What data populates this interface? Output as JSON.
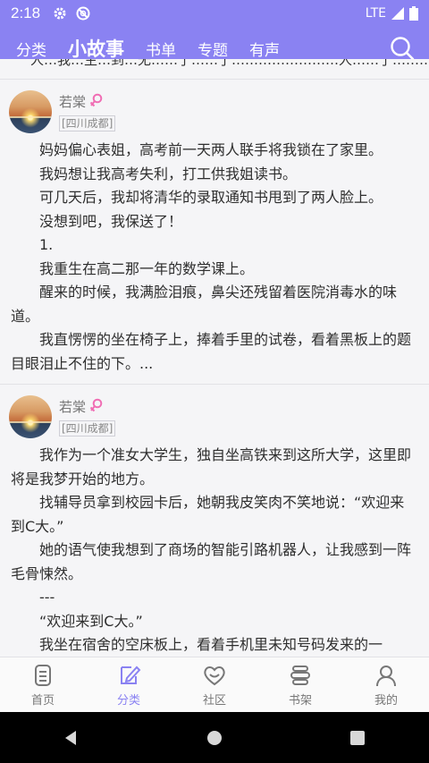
{
  "status_bar": {
    "time": "2:18",
    "network": "LTE"
  },
  "top_nav": {
    "tabs": [
      {
        "label": "分类"
      },
      {
        "label": "小故事"
      },
      {
        "label": "书单"
      },
      {
        "label": "专题"
      },
      {
        "label": "有声"
      }
    ],
    "active_tab": "小故事"
  },
  "cutoff_text": "人…我…生…到…无……了……了……………………人……了……………",
  "posts": [
    {
      "author": "若棠",
      "location": "[四川成都]",
      "paragraphs": [
        "妈妈偏心表姐，高考前一天两人联手将我锁在了家里。",
        "我妈想让我高考失利，打工供我姐读书。",
        "可几天后，我却将清华的录取通知书甩到了两人脸上。",
        "没想到吧，我保送了！",
        "1.",
        "我重生在高二那一年的数学课上。",
        "醒来的时候，我满脸泪痕，鼻尖还残留着医院消毒水的味道。",
        "我直愣愣的坐在椅子上，捧着手里的试卷，看着黑板上的题目眼泪止不住的下。..."
      ]
    },
    {
      "author": "若棠",
      "location": "[四川成都]",
      "paragraphs": [
        "我作为一个准女大学生，独自坐高铁来到这所大学，这里即将是我梦开始的地方。",
        "找辅导员拿到校园卡后，她朝我皮笑肉不笑地说：“欢迎来到C大。”",
        "她的语气使我想到了商场的智能引路机器人，让我感到一阵毛骨悚然。",
        "---",
        "“欢迎来到C大。”",
        "我坐在宿舍的空床板上，看着手机里未知号码发来的一"
      ]
    }
  ],
  "bottom_nav": {
    "items": [
      {
        "label": "首页",
        "icon": "book-stack-icon"
      },
      {
        "label": "分类",
        "icon": "pen-note-icon"
      },
      {
        "label": "社区",
        "icon": "heart-face-icon"
      },
      {
        "label": "书架",
        "icon": "shelf-icon"
      },
      {
        "label": "我的",
        "icon": "profile-icon"
      }
    ],
    "active": "分类"
  },
  "colors": {
    "accent": "#8a82f2",
    "female_icon": "#f06eb4"
  }
}
